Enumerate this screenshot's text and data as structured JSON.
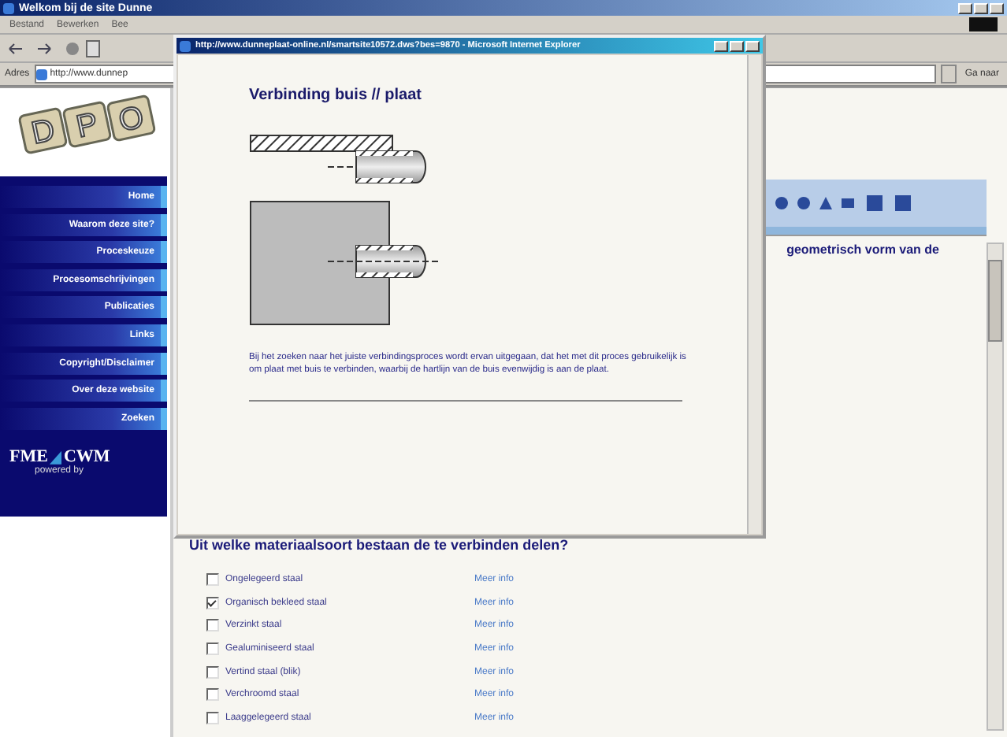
{
  "browser": {
    "title": "Welkom bij de site Dunne",
    "menu": [
      "Bestand",
      "Bewerken",
      "Bee"
    ],
    "address_label": "Adres",
    "address": "http://www.dunnep",
    "go_button": "Ga naar"
  },
  "sidebar": {
    "logo_letters": [
      "D",
      "P",
      "O"
    ],
    "nav": [
      "Home",
      "Waarom deze site?",
      "Proceskeuze",
      "Procesomschrijvingen",
      "Publicaties",
      "Links",
      "Copyright/Disclaimer",
      "Over deze website",
      "Zoeken"
    ],
    "sponsor": {
      "name_left": "FME",
      "name_right": "CWM",
      "tagline": "powered by"
    }
  },
  "page": {
    "partial_text": "geometrisch vorm van de",
    "question": "Uit welke materiaalsoort bestaan de te verbinden delen?",
    "materials": [
      {
        "label": "Ongelegeerd staal",
        "checked": false,
        "link": "Meer info"
      },
      {
        "label": "Organisch bekleed staal",
        "checked": true,
        "link": "Meer info"
      },
      {
        "label": "Verzinkt staal",
        "checked": false,
        "link": "Meer info"
      },
      {
        "label": "Gealuminiseerd staal",
        "checked": false,
        "link": "Meer info"
      },
      {
        "label": "Vertind staal (blik)",
        "checked": false,
        "link": "Meer info"
      },
      {
        "label": "Verchroomd staal",
        "checked": false,
        "link": "Meer info"
      },
      {
        "label": "Laaggelegeerd staal",
        "checked": false,
        "link": "Meer info"
      }
    ]
  },
  "popup": {
    "title": "http://www.dunneplaat-online.nl/smartsite10572.dws?bes=9870 - Microsoft Internet Explorer",
    "heading": "Verbinding buis // plaat",
    "paragraph": "Bij het zoeken naar het juiste verbindingsproces wordt ervan uitgegaan, dat het met dit proces gebruikelijk is om plaat met buis te verbinden, waarbij de hartlijn van de buis evenwijdig is aan de plaat."
  }
}
